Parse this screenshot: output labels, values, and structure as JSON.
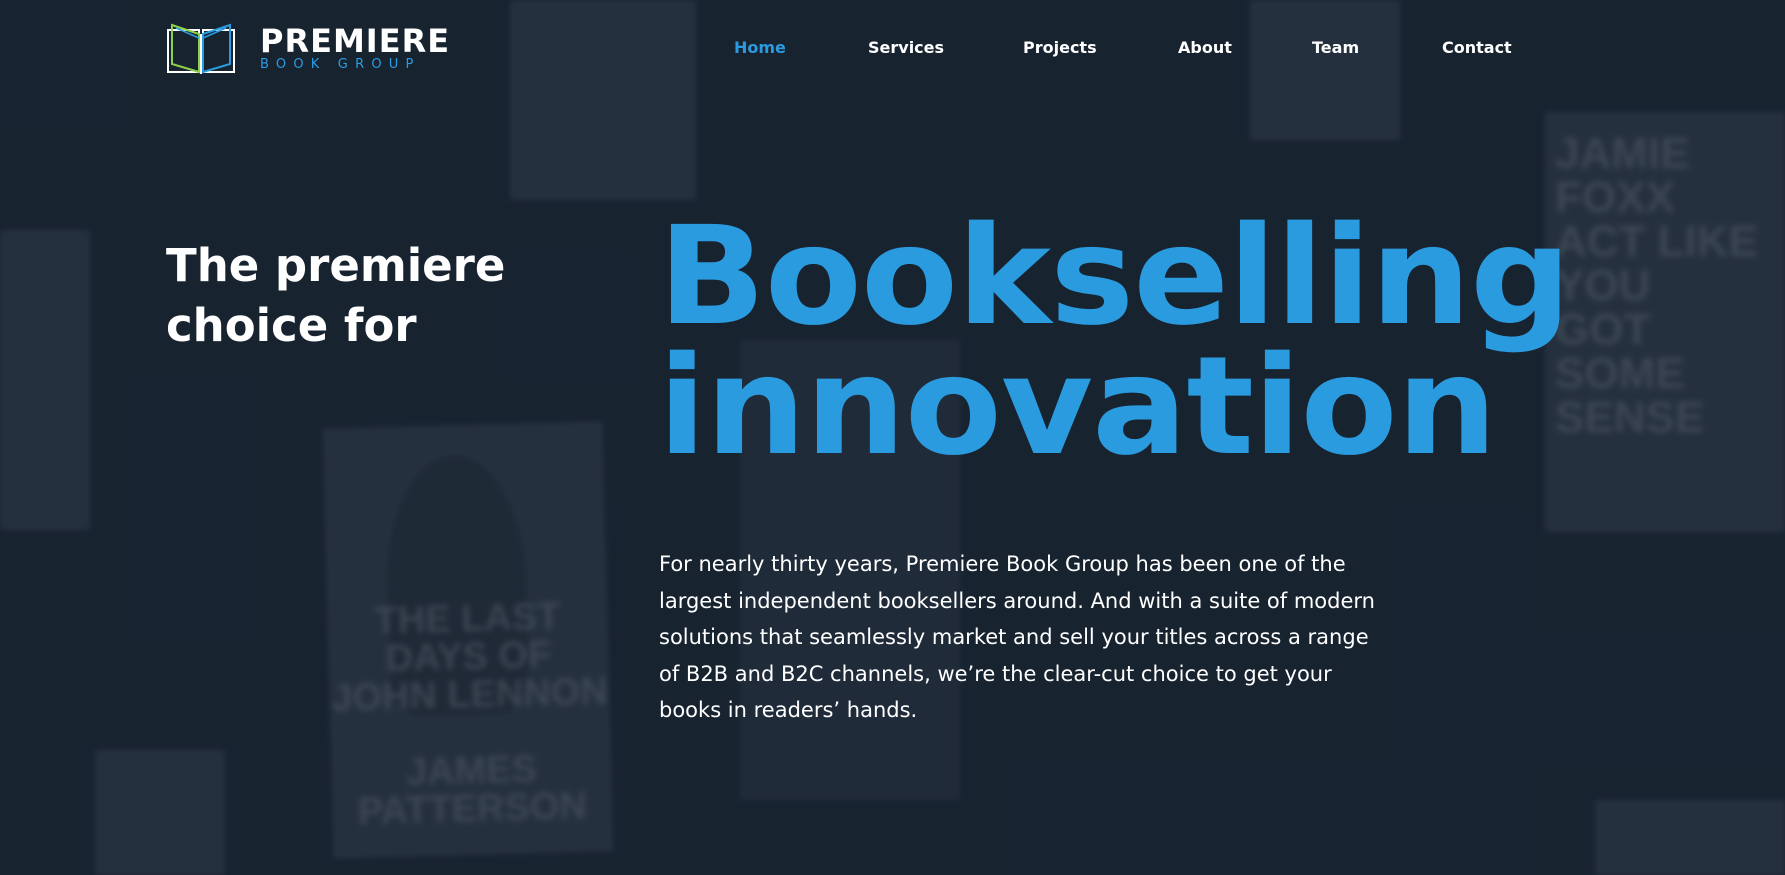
{
  "logo": {
    "name": "PREMIERE",
    "subtitle": "BOOK GROUP"
  },
  "nav": {
    "items": [
      {
        "label": "Home",
        "active": true
      },
      {
        "label": "Services",
        "active": false
      },
      {
        "label": "Projects",
        "active": false
      },
      {
        "label": "About",
        "active": false
      },
      {
        "label": "Team",
        "active": false
      },
      {
        "label": "Contact",
        "active": false
      }
    ]
  },
  "hero": {
    "tagline_line1": "The premiere",
    "tagline_line2": "choice for",
    "headline_line1": "Bookselling",
    "headline_line2": "innovation",
    "body": "For nearly thirty years, Premiere Book Group has been one of the largest independent booksellers around. And with a suite of modern solutions that seamlessly market and sell your titles across a range of B2B and B2C channels, we’re the clear-cut choice to get your books in readers’ hands."
  },
  "background_books": [
    {
      "text": "THE LAST DAYS OF\nJOHN LENNON\n\nJAMES\nPATTERSON"
    },
    {
      "text": "JAMIE FOXX\nACT LIKE YOU\nGOT SOME\nSENSE"
    }
  ],
  "colors": {
    "background": "#182331",
    "accent": "#2b9be0",
    "text": "#ffffff"
  }
}
